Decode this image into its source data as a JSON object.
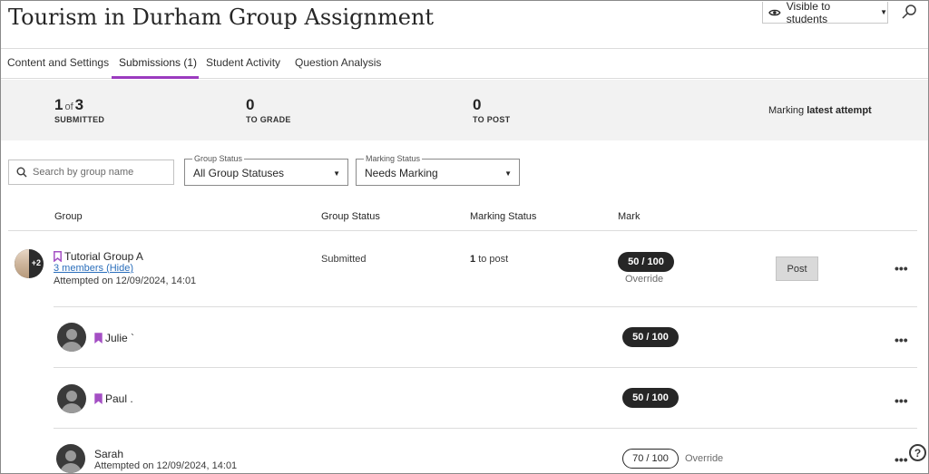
{
  "header": {
    "title": "Tourism in Durham Group Assignment",
    "visibility_label": "Visible to students"
  },
  "tabs": [
    {
      "label": "Content and Settings",
      "active": false
    },
    {
      "label": "Submissions (1)",
      "active": true
    },
    {
      "label": "Student Activity",
      "active": false
    },
    {
      "label": "Question Analysis",
      "active": false
    }
  ],
  "summary": {
    "submitted_count": "1",
    "of_word": "of",
    "submitted_total": "3",
    "submitted_caption": "SUBMITTED",
    "to_grade_count": "0",
    "to_grade_caption": "TO GRADE",
    "to_post_count": "0",
    "to_post_caption": "TO POST",
    "marking_prefix": "Marking",
    "marking_value": "latest attempt"
  },
  "filters": {
    "search_placeholder": "Search by group name",
    "group_status_label": "Group Status",
    "group_status_value": "All Group Statuses",
    "marking_status_label": "Marking Status",
    "marking_status_value": "Needs Marking"
  },
  "table": {
    "columns": [
      "Group",
      "Group Status",
      "Marking Status",
      "Mark"
    ]
  },
  "group": {
    "name": "Tutorial Group A",
    "avatar_extra": "+2",
    "members_link": "3 members (Hide)",
    "attempted": "Attempted on 12/09/2024, 14:01",
    "status": "Submitted",
    "marking_count": "1",
    "marking_suffix": "to post",
    "mark": "50  / 100",
    "override": "Override",
    "post_label": "Post"
  },
  "members": [
    {
      "name": "Julie `",
      "mark": "50  / 100"
    },
    {
      "name": "Paul .",
      "mark": "50  / 100"
    },
    {
      "name": "Sarah",
      "attempted": "Attempted on 12/09/2024, 14:01",
      "mark": "70  / 100",
      "override": "Override"
    }
  ],
  "more_label": "•••",
  "help_label": "?",
  "colors": {
    "accent": "#9b3bbf",
    "link": "#2a6ebb",
    "bookmark": "#a44fc4",
    "summary_bg": "#f2f2f2"
  }
}
